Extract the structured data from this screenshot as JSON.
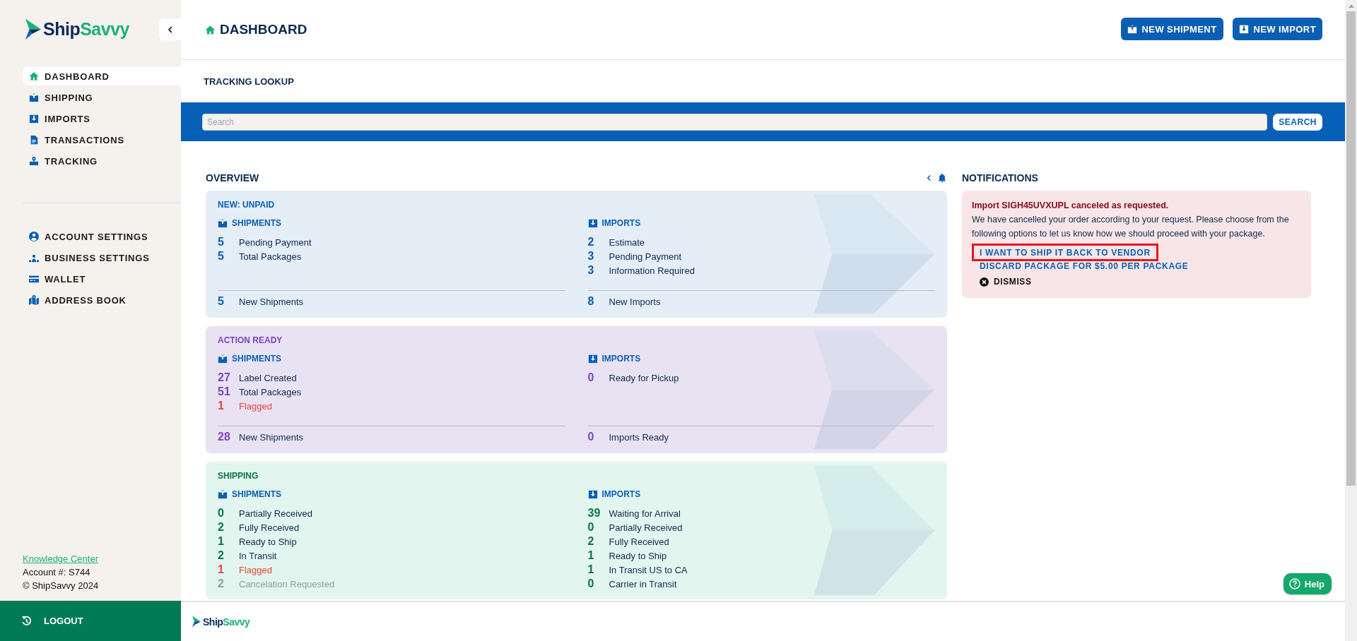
{
  "sidebar": {
    "logo": {
      "first": "Ship",
      "second": "Savvy"
    },
    "nav": [
      {
        "label": "DASHBOARD",
        "selected": true
      },
      {
        "label": "SHIPPING",
        "selected": false
      },
      {
        "label": "IMPORTS",
        "selected": false
      },
      {
        "label": "TRANSACTIONS",
        "selected": false
      },
      {
        "label": "TRACKING",
        "selected": false
      }
    ],
    "settings": [
      {
        "label": "ACCOUNT SETTINGS",
        "selected": false
      },
      {
        "label": "BUSINESS SETTINGS",
        "selected": false
      },
      {
        "label": "WALLET",
        "selected": false
      },
      {
        "label": "ADDRESS BOOK",
        "selected": false
      }
    ],
    "info": {
      "link": "Knowledge Center",
      "account": "Account #: S744",
      "copyright": "© ShipSavvy 2024"
    },
    "logout": "LOGOUT"
  },
  "header": {
    "title": "DASHBOARD",
    "buttons": [
      {
        "label": "NEW SHIPMENT",
        "kind": "shipment"
      },
      {
        "label": "NEW IMPORT",
        "kind": "import"
      }
    ]
  },
  "tracking": {
    "title": "TRACKING LOOKUP",
    "placeholder": "Search",
    "button": "SEARCH"
  },
  "overview": {
    "title": "OVERVIEW",
    "cards": [
      {
        "title": "NEW: UNPAID",
        "kind": "unpaid",
        "columns": [
          {
            "kind": "shipments",
            "heading": "SHIPMENTS",
            "rows": [
              {
                "count": "5",
                "label": "Pending Payment",
                "kind": "normal"
              },
              {
                "count": "5",
                "label": "Total Packages",
                "kind": "normal"
              }
            ],
            "total": {
              "count": "5",
              "label": "New Shipments"
            }
          },
          {
            "kind": "imports",
            "heading": "IMPORTS",
            "rows": [
              {
                "count": "2",
                "label": "Estimate",
                "kind": "normal"
              },
              {
                "count": "3",
                "label": "Pending Payment",
                "kind": "normal"
              },
              {
                "count": "3",
                "label": "Information Required",
                "kind": "normal"
              }
            ],
            "total": {
              "count": "8",
              "label": "New Imports"
            }
          }
        ]
      },
      {
        "title": "ACTION READY",
        "kind": "ready",
        "columns": [
          {
            "kind": "shipments",
            "heading": "SHIPMENTS",
            "rows": [
              {
                "count": "27",
                "label": "Label Created",
                "kind": "normal"
              },
              {
                "count": "51",
                "label": "Total Packages",
                "kind": "normal"
              },
              {
                "count": "1",
                "label": "Flagged",
                "kind": "flagged"
              }
            ],
            "total": {
              "count": "28",
              "label": "New Shipments"
            }
          },
          {
            "kind": "imports",
            "heading": "IMPORTS",
            "rows": [
              {
                "count": "0",
                "label": "Ready for Pickup",
                "kind": "normal"
              }
            ],
            "total": {
              "count": "0",
              "label": "Imports Ready"
            }
          }
        ]
      },
      {
        "title": "SHIPPING",
        "kind": "shipping",
        "columns": [
          {
            "kind": "shipments",
            "heading": "SHIPMENTS",
            "rows": [
              {
                "count": "0",
                "label": "Partially Received",
                "kind": "normal"
              },
              {
                "count": "2",
                "label": "Fully Received",
                "kind": "normal"
              },
              {
                "count": "1",
                "label": "Ready to Ship",
                "kind": "normal"
              },
              {
                "count": "2",
                "label": "In Transit",
                "kind": "normal"
              },
              {
                "count": "1",
                "label": "Flagged",
                "kind": "flagged"
              },
              {
                "count": "2",
                "label": "Cancelation Requested",
                "kind": "muted"
              }
            ]
          },
          {
            "kind": "imports",
            "heading": "IMPORTS",
            "rows": [
              {
                "count": "39",
                "label": "Waiting for Arrival",
                "kind": "normal"
              },
              {
                "count": "0",
                "label": "Partially Received",
                "kind": "normal"
              },
              {
                "count": "2",
                "label": "Fully Received",
                "kind": "normal"
              },
              {
                "count": "1",
                "label": "Ready to Ship",
                "kind": "normal"
              },
              {
                "count": "1",
                "label": "In Transit US to CA",
                "kind": "normal"
              },
              {
                "count": "0",
                "label": "Carrier in Transit",
                "kind": "normal"
              }
            ]
          }
        ]
      }
    ]
  },
  "notifications": {
    "title": "NOTIFICATIONS",
    "items": [
      {
        "title": "Import SIGH45UVXUPL canceled as requested.",
        "body": "We have cancelled your order according to your request. Please choose from the following options to let us know how we should proceed with your package.",
        "actions": [
          {
            "label": "I WANT TO SHIP IT BACK TO VENDOR",
            "highlighted": true
          },
          {
            "label": "DISCARD PACKAGE FOR $5.00 PER PACKAGE",
            "highlighted": false
          }
        ],
        "dismiss": "DISMISS"
      }
    ]
  },
  "footer": {
    "logo": {
      "first": "Ship",
      "second": "Savvy"
    }
  },
  "help": "Help"
}
